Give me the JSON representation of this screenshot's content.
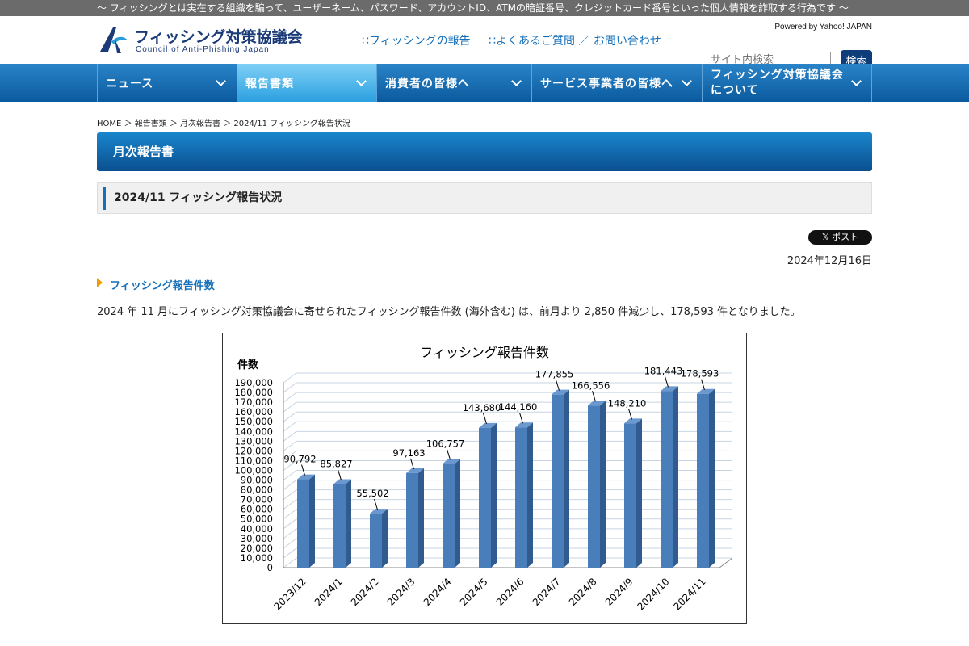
{
  "topbar": {
    "text": "～ フィッシングとは実在する組織を騙って、ユーザーネーム、パスワード、アカウントID、ATMの暗証番号、クレジットカード番号といった個人情報を詐取する行為です ～"
  },
  "logo": {
    "jp": "フィッシング対策協議会",
    "en": "Council of Anti-Phishing Japan"
  },
  "header_links": {
    "report": "∷フィッシングの報告",
    "faq": "∷よくあるご質問 ／ お問い合わせ"
  },
  "search": {
    "powered": "Powered by Yahoo! JAPAN",
    "placeholder": "サイト内検索",
    "button": "検索"
  },
  "nav": {
    "news": "ニュース",
    "reports": "報告書類",
    "consumers": "消費者の皆様へ",
    "providers": "サービス事業者の皆様へ",
    "about_line1": "フィッシング対策協議会",
    "about_line2": "について"
  },
  "breadcrumb": "HOME ＞ 報告書類 ＞ 月次報告書 ＞ 2024/11 フィッシング報告状況",
  "section_title": "月次報告書",
  "page_subtitle": "2024/11 フィッシング報告状況",
  "post_button": "𝕏 ポスト",
  "date": "2024年12月16日",
  "heading": "フィッシング報告件数",
  "paragraph": "2024 年 11 月にフィッシング対策協議会に寄せられたフィッシング報告件数 (海外含む) は、前月より 2,850 件減少し、178,593 件となりました。",
  "colors": {
    "bar": "#4a7ebb",
    "bar_side": "#2f5b8f",
    "nav_active": "#3aa8e4",
    "accent": "#1570b9"
  },
  "chart_data": {
    "type": "bar",
    "title": "フィッシング報告件数",
    "ylabel": "件数",
    "xlabel": "",
    "categories": [
      "2023/12",
      "2024/1",
      "2024/2",
      "2024/3",
      "2024/4",
      "2024/5",
      "2024/6",
      "2024/7",
      "2024/8",
      "2024/9",
      "2024/10",
      "2024/11"
    ],
    "values": [
      90792,
      85827,
      55502,
      97163,
      106757,
      143680,
      144160,
      177855,
      166556,
      148210,
      181443,
      178593
    ],
    "value_labels": [
      "90,792",
      "85,827",
      "55,502",
      "97,163",
      "106,757",
      "143,680",
      "144,160",
      "177,855",
      "166,556",
      "148,210",
      "181,443",
      "178,593"
    ],
    "ylim": [
      0,
      190000
    ],
    "ytick_labels": [
      "0",
      "10,000",
      "20,000",
      "30,000",
      "40,000",
      "50,000",
      "60,000",
      "70,000",
      "80,000",
      "90,000",
      "100,000",
      "110,000",
      "120,000",
      "130,000",
      "140,000",
      "150,000",
      "160,000",
      "170,000",
      "180,000",
      "190,000"
    ],
    "grid": true,
    "legend": "none"
  }
}
